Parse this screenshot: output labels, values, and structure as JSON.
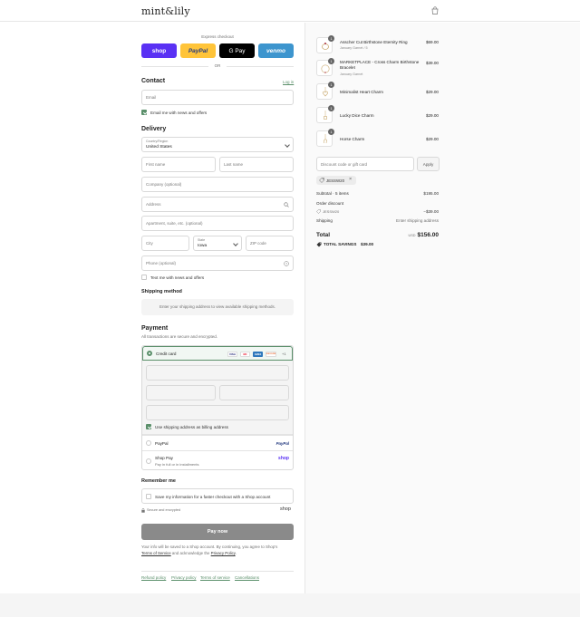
{
  "brand": {
    "logo_text": "mint&lily"
  },
  "express": {
    "label": "Express checkout",
    "buttons": [
      {
        "label": "shop",
        "bg": "#5a31f4",
        "fg": "#ffffff"
      },
      {
        "label": "PayPal",
        "bg": "#ffc439",
        "fg": "#253b80"
      },
      {
        "label": "G Pay",
        "bg": "#000000",
        "fg": "#ffffff"
      },
      {
        "label": "venmo",
        "bg": "#3d95ce",
        "fg": "#ffffff"
      }
    ],
    "or_label": "OR"
  },
  "contact": {
    "title": "Contact",
    "login_link": "Log in",
    "email_placeholder": "Email",
    "news_label": "Email me with news and offers"
  },
  "delivery": {
    "title": "Delivery",
    "country_label": "Country/Region",
    "country_value": "United States",
    "first_name_placeholder": "First name",
    "last_name_placeholder": "Last name",
    "company_placeholder": "Company (optional)",
    "address_placeholder": "Address",
    "apartment_placeholder": "Apartment, suite, etc. (optional)",
    "city_placeholder": "City",
    "state_label": "State",
    "state_value": "Iowa",
    "zip_placeholder": "ZIP code",
    "phone_placeholder": "Phone (optional)",
    "text_label": "Text me with news and offers"
  },
  "shipping": {
    "title": "Shipping method",
    "message": "Enter your shipping address to view available shipping methods."
  },
  "payment": {
    "title": "Payment",
    "subtitle": "All transactions are secure and encrypted.",
    "credit_card_label": "Credit card",
    "card_logos": [
      {
        "label": "VISA",
        "bg": "#ffffff",
        "fg": "#1a1f71"
      },
      {
        "label": "MC",
        "bg": "#ffffff",
        "fg": "#eb001b"
      },
      {
        "label": "AMEX",
        "bg": "#2e77bc",
        "fg": "#ffffff"
      },
      {
        "label": "DISCOVER",
        "bg": "#ffffff",
        "fg": "#e55c20"
      }
    ],
    "more_cards": "+1",
    "billing_label": "Use shipping address as billing address",
    "paypal_label": "PayPal",
    "paypal_logo": "PayPal",
    "shoppay_label": "Shop Pay",
    "shoppay_sub": "Pay in full or in installments",
    "shoppay_logo": "shop"
  },
  "remember": {
    "title": "Remember me",
    "save_label": "Save my information for a faster checkout with a Shop account",
    "secure_label": "Secure and encrypted",
    "shop_logo": "shop"
  },
  "pay_now_label": "Pay now",
  "legal": {
    "line1": "Your info will be saved to a Shop account. By continuing, you agree to Shop's",
    "terms": "Terms of Service",
    "and_text": " and acknowledge the ",
    "privacy": "Privacy Policy",
    "end": "."
  },
  "footer_links": [
    "Refund policy",
    "Privacy policy",
    "Terms of service",
    "Cancellations"
  ],
  "cart": {
    "items": [
      {
        "name": "Asscher Cut Birthstone Eternity Ring",
        "variant": "January Garnet / 5",
        "price": "$69.00",
        "qty": "1"
      },
      {
        "name": "MARKETPLACE - Cross Charm Birthstone Bracelet",
        "variant": "January Garnet",
        "price": "$39.00",
        "qty": "1"
      },
      {
        "name": "Minimalist Heart Charm",
        "variant": "",
        "price": "$29.00",
        "qty": "1"
      },
      {
        "name": "Lucky Dice Charm",
        "variant": "",
        "price": "$29.00",
        "qty": "1"
      },
      {
        "name": "Horse Charm",
        "variant": "",
        "price": "$29.00",
        "qty": "1"
      }
    ],
    "discount_placeholder": "Discount code or gift card",
    "apply_label": "Apply",
    "applied_code": "JESSW20",
    "subtotal_label": "Subtotal · 5 items",
    "subtotal_value": "$195.00",
    "order_discount_label": "Order discount",
    "discount_code": "JESSW20",
    "discount_value": "−$39.00",
    "shipping_label": "Shipping",
    "shipping_value": "Enter shipping address",
    "total_label": "Total",
    "currency": "USD",
    "total_value": "$156.00",
    "savings_label": "TOTAL SAVINGS",
    "savings_value": "$39.00"
  }
}
